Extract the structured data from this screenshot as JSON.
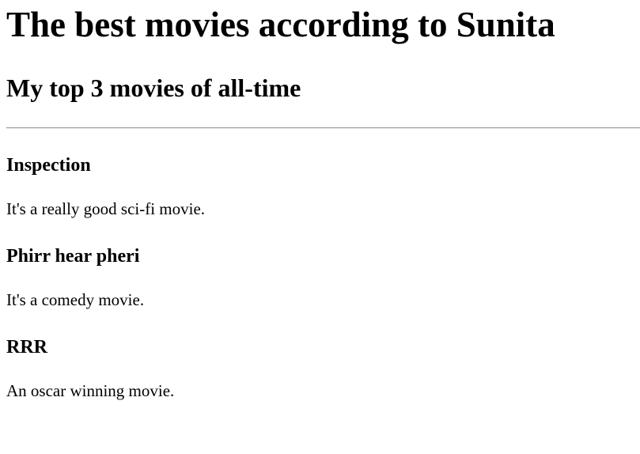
{
  "header": {
    "title": "The best movies according to Sunita",
    "subtitle": "My top 3 movies of all-time"
  },
  "movies": [
    {
      "title": "Inspection",
      "description": "It's a really good sci-fi movie."
    },
    {
      "title": "Phirr hear pheri",
      "description": "It's a comedy movie."
    },
    {
      "title": "RRR",
      "description": "An oscar winning movie."
    }
  ]
}
